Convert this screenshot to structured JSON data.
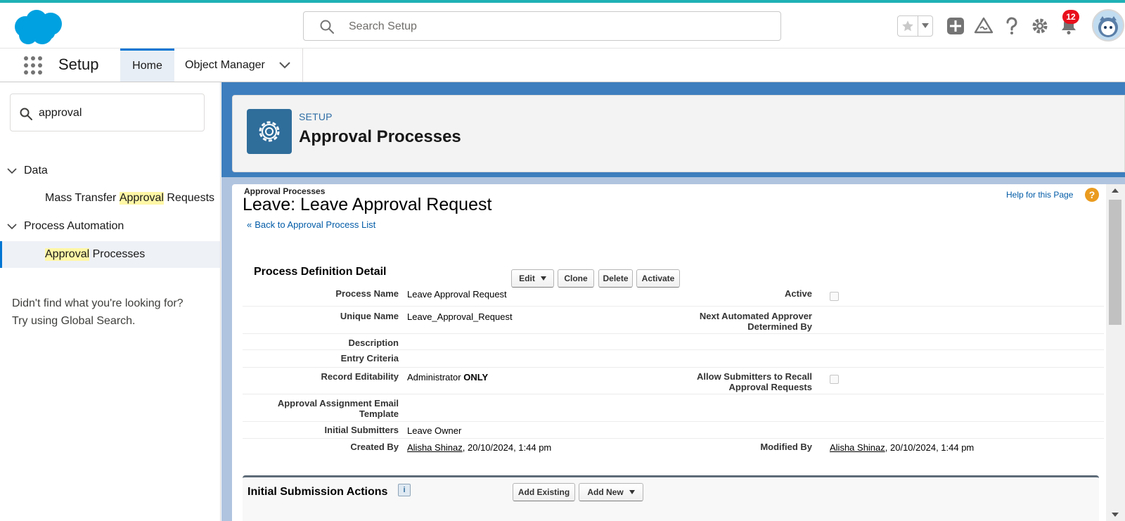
{
  "header": {
    "search_placeholder": "Search Setup",
    "notification_count": "12"
  },
  "app_nav": {
    "app_name": "Setup",
    "tabs": [
      {
        "label": "Home"
      },
      {
        "label": "Object Manager"
      }
    ]
  },
  "sidebar": {
    "quick_find_value": "approval",
    "groups": [
      {
        "label": "Data",
        "items": [
          {
            "pre": "Mass Transfer ",
            "hl": "Approval",
            "post": " Requests"
          }
        ]
      },
      {
        "label": "Process Automation",
        "items": [
          {
            "pre": "",
            "hl": "Approval",
            "post": " Processes"
          }
        ]
      }
    ],
    "not_found_line1": "Didn't find what you're looking for?",
    "not_found_line2": "Try using Global Search."
  },
  "page_header": {
    "eyebrow": "SETUP",
    "title": "Approval Processes"
  },
  "detail_page": {
    "breadcrumb": "Approval Processes",
    "title": "Leave: Leave Approval Request",
    "back_arrow": "«",
    "back_link": "Back to Approval Process List",
    "help_link": "Help for this Page",
    "help_icon_glyph": "?",
    "section_title": "Process Definition Detail",
    "buttons": {
      "edit": "Edit",
      "clone": "Clone",
      "delete": "Delete",
      "activate": "Activate"
    },
    "fields": {
      "process_name_label": "Process Name",
      "process_name_value": "Leave Approval Request",
      "active_label": "Active",
      "unique_name_label": "Unique Name",
      "unique_name_value": "Leave_Approval_Request",
      "next_approver_label_1": "Next Automated Approver",
      "next_approver_label_2": "Determined By",
      "description_label": "Description",
      "entry_criteria_label": "Entry Criteria",
      "record_editability_label": "Record Editability",
      "record_editability_value": "Administrator",
      "record_editability_value_bold": "ONLY",
      "allow_recall_label_1": "Allow Submitters to Recall",
      "allow_recall_label_2": "Approval Requests",
      "email_template_label_1": "Approval Assignment Email",
      "email_template_label_2": "Template",
      "initial_submitters_label": "Initial Submitters",
      "initial_submitters_value": "Leave Owner",
      "created_by_label": "Created By",
      "created_by_user": "Alisha Shinaz",
      "created_by_date": ", 20/10/2024, 1:44 pm",
      "modified_by_label": "Modified By",
      "modified_by_user": "Alisha Shinaz",
      "modified_by_date": ", 20/10/2024, 1:44 pm"
    },
    "initial_submission": {
      "title": "Initial Submission Actions",
      "info_glyph": "i",
      "add_existing": "Add Existing",
      "add_new": "Add New"
    }
  },
  "colors": {
    "accent_line": "#1fb1b5",
    "brand_blue": "#0176d3",
    "link_blue": "#015ba7",
    "setup_icon_bg": "#2f6d9b",
    "notification_red": "#e8101c"
  }
}
